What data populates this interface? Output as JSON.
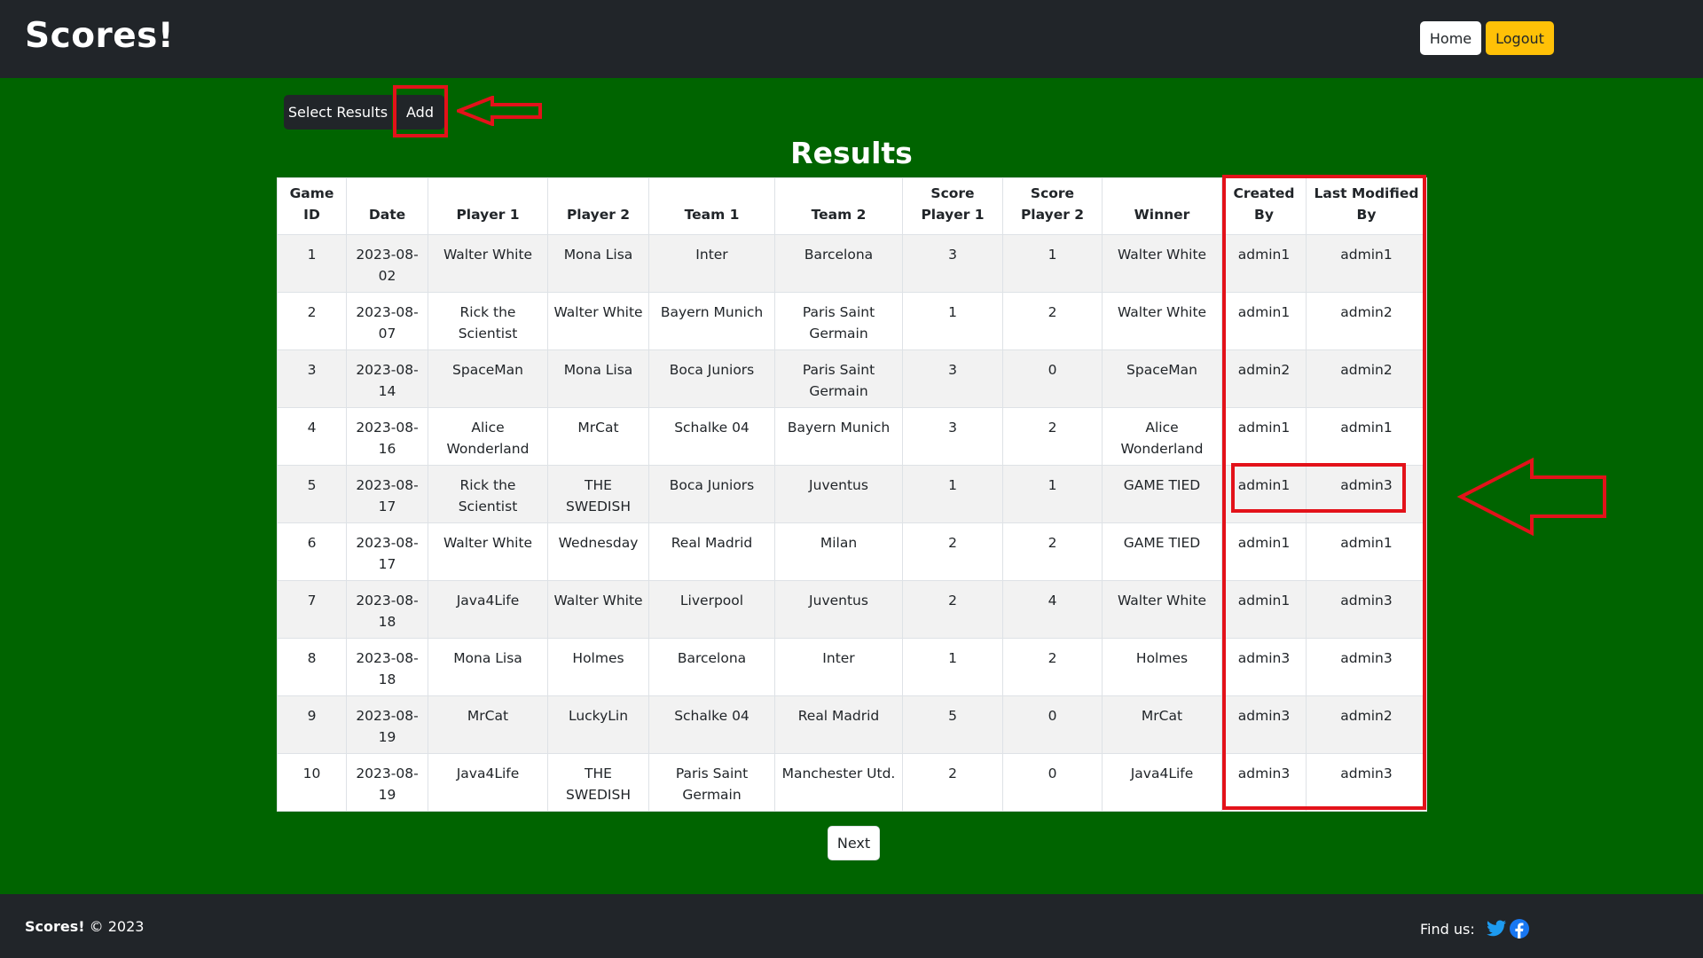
{
  "navbar": {
    "brand": "Scores!",
    "home_label": "Home",
    "logout_label": "Logout"
  },
  "toolbar": {
    "select_results_label": "Select Results",
    "add_label": "Add"
  },
  "page_title": "Results",
  "table": {
    "headers": [
      "Game ID",
      "Date",
      "Player 1",
      "Player 2",
      "Team 1",
      "Team 2",
      "Score Player 1",
      "Score Player 2",
      "Winner",
      "Created By",
      "Last Modified By"
    ],
    "rows": [
      [
        "1",
        "2023-08-02",
        "Walter White",
        "Mona Lisa",
        "Inter",
        "Barcelona",
        "3",
        "1",
        "Walter White",
        "admin1",
        "admin1"
      ],
      [
        "2",
        "2023-08-07",
        "Rick the Scientist",
        "Walter White",
        "Bayern Munich",
        "Paris Saint Germain",
        "1",
        "2",
        "Walter White",
        "admin1",
        "admin2"
      ],
      [
        "3",
        "2023-08-14",
        "SpaceMan",
        "Mona Lisa",
        "Boca Juniors",
        "Paris Saint Germain",
        "3",
        "0",
        "SpaceMan",
        "admin2",
        "admin2"
      ],
      [
        "4",
        "2023-08-16",
        "Alice Wonderland",
        "MrCat",
        "Schalke 04",
        "Bayern Munich",
        "3",
        "2",
        "Alice Wonderland",
        "admin1",
        "admin1"
      ],
      [
        "5",
        "2023-08-17",
        "Rick the Scientist",
        "THE SWEDISH",
        "Boca Juniors",
        "Juventus",
        "1",
        "1",
        "GAME TIED",
        "admin1",
        "admin3"
      ],
      [
        "6",
        "2023-08-17",
        "Walter White",
        "Wednesday",
        "Real Madrid",
        "Milan",
        "2",
        "2",
        "GAME TIED",
        "admin1",
        "admin1"
      ],
      [
        "7",
        "2023-08-18",
        "Java4Life",
        "Walter White",
        "Liverpool",
        "Juventus",
        "2",
        "4",
        "Walter White",
        "admin1",
        "admin3"
      ],
      [
        "8",
        "2023-08-18",
        "Mona Lisa",
        "Holmes",
        "Barcelona",
        "Inter",
        "1",
        "2",
        "Holmes",
        "admin3",
        "admin3"
      ],
      [
        "9",
        "2023-08-19",
        "MrCat",
        "LuckyLin",
        "Schalke 04",
        "Real Madrid",
        "5",
        "0",
        "MrCat",
        "admin3",
        "admin2"
      ],
      [
        "10",
        "2023-08-19",
        "Java4Life",
        "THE SWEDISH",
        "Paris Saint Germain",
        "Manchester Utd.",
        "2",
        "0",
        "Java4Life",
        "admin3",
        "admin3"
      ]
    ]
  },
  "pagination": {
    "next_label": "Next"
  },
  "footer": {
    "brand": "Scores!",
    "copyright": "© 2023",
    "find_us_label": "Find us:",
    "social_icons": [
      "twitter-icon",
      "facebook-icon"
    ]
  },
  "colors": {
    "page_background": "#006400",
    "navbar": "#212529",
    "logout_button": "#ffc107",
    "annotation": "#e3121a"
  }
}
